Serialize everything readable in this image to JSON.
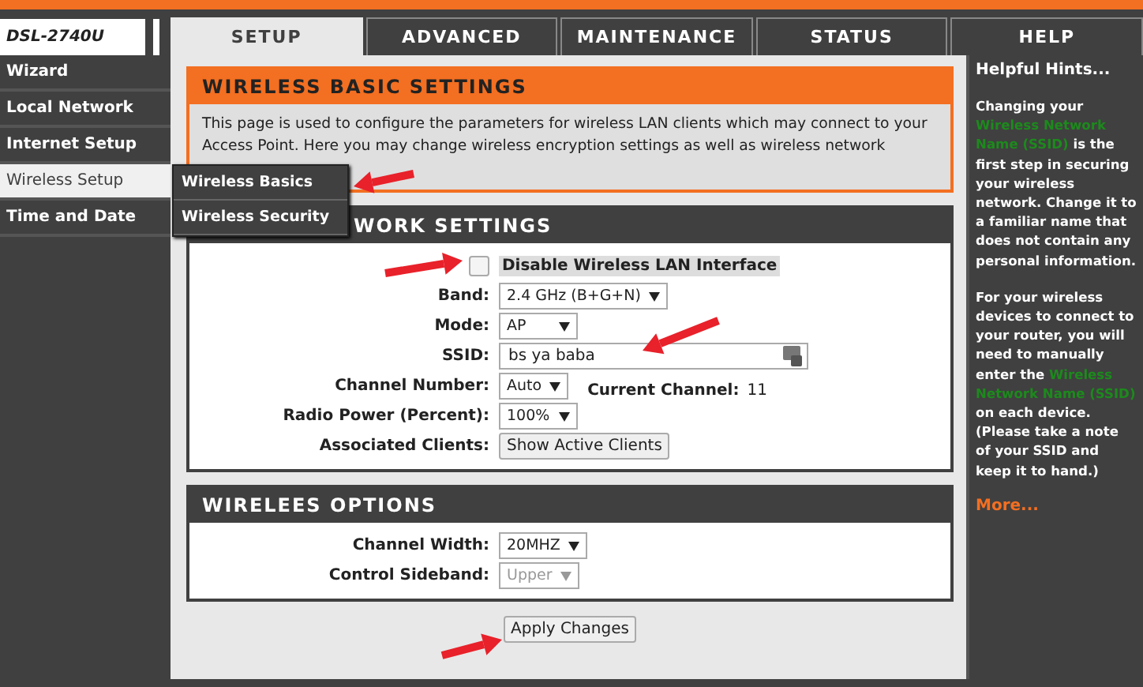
{
  "header": {
    "model": "DSL-2740U",
    "tabs": [
      {
        "label": "SETUP",
        "selected": true
      },
      {
        "label": "ADVANCED",
        "selected": false
      },
      {
        "label": "MAINTENANCE",
        "selected": false
      },
      {
        "label": "STATUS",
        "selected": false
      },
      {
        "label": "HELP",
        "selected": false
      }
    ]
  },
  "sidebar": {
    "items": [
      {
        "label": "Wizard",
        "selected": false
      },
      {
        "label": "Local Network",
        "selected": false
      },
      {
        "label": "Internet Setup",
        "selected": false
      },
      {
        "label": "Wireless Setup",
        "selected": true
      },
      {
        "label": "Time and Date",
        "selected": false
      }
    ],
    "submenu": [
      "Wireless Basics",
      "Wireless Security"
    ]
  },
  "basic": {
    "title": "WIRELESS BASIC SETTINGS",
    "description": "This page is used to configure the parameters for wireless LAN clients which may connect to your Access Point. Here you may change wireless encryption settings as well as wireless network"
  },
  "network": {
    "title": "WORK SETTINGS",
    "disable_interface": {
      "label": "Disable Wireless LAN Interface",
      "checked": false
    },
    "rows": [
      {
        "kind": "select",
        "label": "Band:",
        "value": "2.4 GHz (B+G+N)",
        "disabled": false
      },
      {
        "kind": "select",
        "label": "Mode:",
        "value": "AP",
        "disabled": false
      },
      {
        "kind": "input",
        "label": "SSID:",
        "value": "bs ya baba"
      },
      {
        "kind": "channel",
        "label": "Channel Number:",
        "value": "Auto",
        "disabled": false,
        "current_label": "Current Channel:",
        "current_value": "11"
      },
      {
        "kind": "select",
        "label": "Radio Power (Percent):",
        "value": "100%",
        "disabled": false
      },
      {
        "kind": "button",
        "label": "Associated Clients:",
        "value": "Show Active Clients"
      }
    ]
  },
  "options": {
    "title": "WIRELEES OPTIONS",
    "rows": [
      {
        "kind": "select",
        "label": "Channel Width:",
        "value": "20MHZ",
        "disabled": false
      },
      {
        "kind": "select",
        "label": "Control Sideband:",
        "value": "Upper",
        "disabled": true
      }
    ]
  },
  "apply_button": "Apply Changes",
  "hints": {
    "title": "Helpful Hints...",
    "paragraphs": [
      [
        {
          "text": "Changing your ",
          "highlight": false
        },
        {
          "text": "Wireless Network Name (SSID)",
          "highlight": true
        },
        {
          "text": " is the first step in securing your wireless network. Change it to a familiar name that does not contain any personal information.",
          "highlight": false
        }
      ],
      [
        {
          "text": "For your wireless devices to connect to your router, you will need to manually enter the ",
          "highlight": false
        },
        {
          "text": "Wireless Network Name (SSID)",
          "highlight": true
        },
        {
          "text": " on each device. (Please take a note of your SSID and keep it to hand.)",
          "highlight": false
        }
      ]
    ],
    "more": "More..."
  }
}
